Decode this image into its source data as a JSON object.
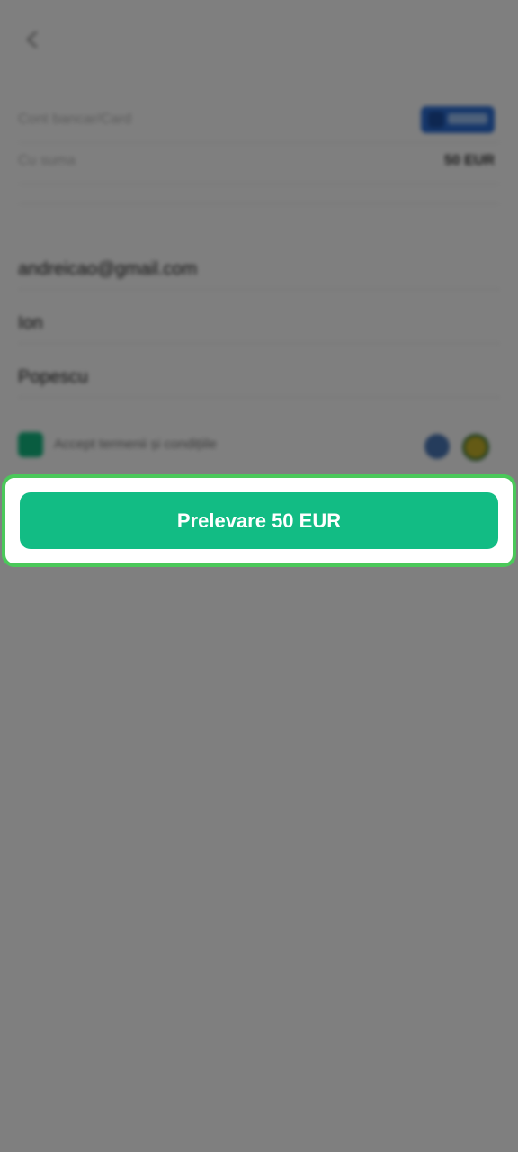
{
  "form": {
    "method_label": "Cont bancar/Card",
    "amount_label": "Cu suma",
    "amount_value": "50 EUR",
    "email_value": "andreicao@gmail.com",
    "first_name_value": "Ion",
    "last_name_value": "Popescu",
    "consent_label": "Accept termenii și condițiile"
  },
  "cta": {
    "label": "Prelevare 50 EUR"
  },
  "colors": {
    "accent": "#12bc84",
    "highlight_border": "#4bc85a",
    "overlay": "rgba(0,0,0,0.5)"
  }
}
